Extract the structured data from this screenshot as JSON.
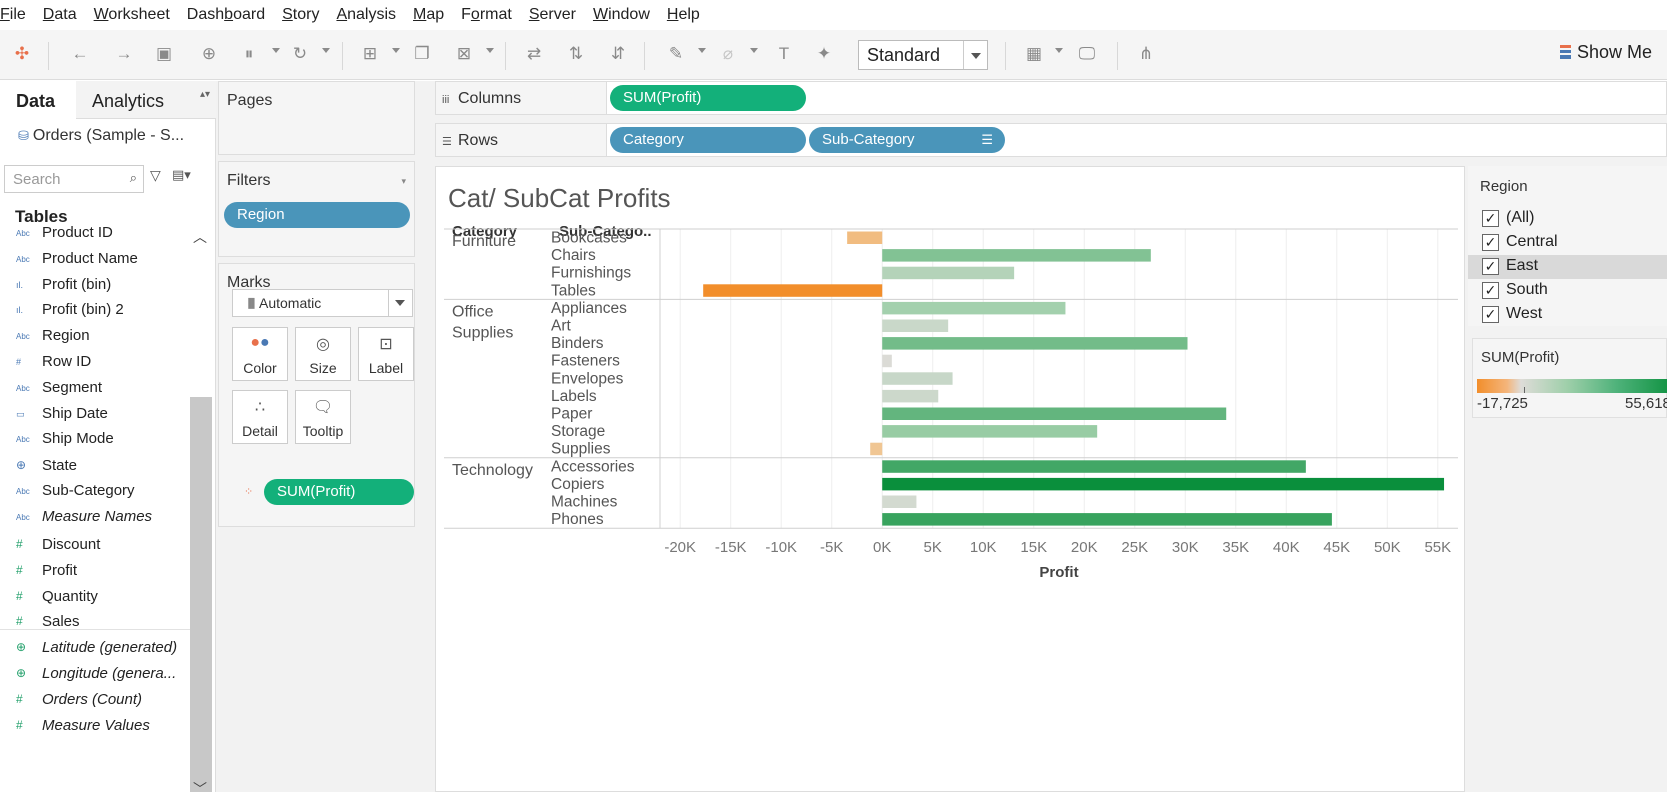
{
  "menu": [
    {
      "pre": "",
      "u": "F",
      "post": "ile"
    },
    {
      "pre": "",
      "u": "D",
      "post": "ata"
    },
    {
      "pre": "",
      "u": "W",
      "post": "orksheet"
    },
    {
      "pre": "Dash",
      "u": "b",
      "post": "oard"
    },
    {
      "pre": "",
      "u": "S",
      "post": "tory"
    },
    {
      "pre": "",
      "u": "A",
      "post": "nalysis"
    },
    {
      "pre": "",
      "u": "M",
      "post": "ap"
    },
    {
      "pre": "F",
      "u": "o",
      "post": "rmat"
    },
    {
      "pre": "",
      "u": "S",
      "post": "erver"
    },
    {
      "pre": "",
      "u": "W",
      "post": "indow"
    },
    {
      "pre": "",
      "u": "H",
      "post": "elp"
    }
  ],
  "toolbar": {
    "fit_select": "Standard",
    "show_me": "Show Me"
  },
  "datapane": {
    "tab_data": "Data",
    "tab_analytics": "Analytics",
    "datasource": "Orders (Sample - S...",
    "search_placeholder": "Search",
    "tables_heading": "Tables",
    "dimensions": [
      {
        "name": "Product ID",
        "type": "Abc"
      },
      {
        "name": "Product Name",
        "type": "Abc"
      },
      {
        "name": "Profit (bin)",
        "type": "bin"
      },
      {
        "name": "Profit (bin) 2",
        "type": "bin"
      },
      {
        "name": "Region",
        "type": "Abc"
      },
      {
        "name": "Row ID",
        "type": "#"
      },
      {
        "name": "Segment",
        "type": "Abc"
      },
      {
        "name": "Ship Date",
        "type": "date"
      },
      {
        "name": "Ship Mode",
        "type": "Abc"
      },
      {
        "name": "State",
        "type": "geo"
      },
      {
        "name": "Sub-Category",
        "type": "Abc"
      },
      {
        "name": "Measure Names",
        "type": "Abc",
        "italic": true
      }
    ],
    "measures": [
      {
        "name": "Discount",
        "type": "#"
      },
      {
        "name": "Profit",
        "type": "#"
      },
      {
        "name": "Quantity",
        "type": "#"
      },
      {
        "name": "Sales",
        "type": "#"
      },
      {
        "name": "Latitude (generated)",
        "type": "geo",
        "italic": true
      },
      {
        "name": "Longitude (genera...",
        "type": "geo",
        "italic": true
      },
      {
        "name": "Orders (Count)",
        "type": "#",
        "italic": true
      },
      {
        "name": "Measure Values",
        "type": "#",
        "italic": true
      }
    ]
  },
  "pages_title": "Pages",
  "filters": {
    "title": "Filters",
    "pill": "Region"
  },
  "marks": {
    "title": "Marks",
    "type": "Automatic",
    "buttons": [
      "Color",
      "Size",
      "Label",
      "Detail",
      "Tooltip"
    ],
    "pill": "SUM(Profit)"
  },
  "shelves": {
    "columns_label": "Columns",
    "rows_label": "Rows",
    "columns_pill": "SUM(Profit)",
    "rows_pills": [
      "Category",
      "Sub-Category"
    ]
  },
  "viz": {
    "title": "Cat/ SubCat Profits",
    "header_category": "Category",
    "header_subcategory": "Sub-Catego.."
  },
  "region_filter": {
    "title": "Region",
    "items": [
      {
        "label": "(All)",
        "checked": true
      },
      {
        "label": "Central",
        "checked": true
      },
      {
        "label": "East",
        "checked": true,
        "selected": true
      },
      {
        "label": "South",
        "checked": true
      },
      {
        "label": "West",
        "checked": true
      }
    ]
  },
  "color_legend": {
    "title": "SUM(Profit)",
    "min_label": "-17,725",
    "max_label": "55,618",
    "colors": {
      "negative": "#f28e2b",
      "neutral": "#dedcd8",
      "positive": "#0a8f3c"
    }
  },
  "chart_data": {
    "type": "bar",
    "orientation": "horizontal",
    "xlabel": "Profit",
    "xlim": [
      -22000,
      57000
    ],
    "xticks": [
      "-20K",
      "-15K",
      "-10K",
      "-5K",
      "0K",
      "5K",
      "10K",
      "15K",
      "20K",
      "25K",
      "30K",
      "35K",
      "40K",
      "45K",
      "50K",
      "55K"
    ],
    "xtick_values": [
      -20000,
      -15000,
      -10000,
      -5000,
      0,
      5000,
      10000,
      15000,
      20000,
      25000,
      30000,
      35000,
      40000,
      45000,
      50000,
      55000
    ],
    "groups": [
      {
        "category_line1": "Furniture",
        "category_line2": "",
        "rows": [
          {
            "sub": "Bookcases",
            "value": -3473
          },
          {
            "sub": "Chairs",
            "value": 26590
          },
          {
            "sub": "Furnishings",
            "value": 13059
          },
          {
            "sub": "Tables",
            "value": -17725
          }
        ]
      },
      {
        "category_line1": "Office",
        "category_line2": "Supplies",
        "rows": [
          {
            "sub": "Appliances",
            "value": 18138
          },
          {
            "sub": "Art",
            "value": 6528
          },
          {
            "sub": "Binders",
            "value": 30222
          },
          {
            "sub": "Fasteners",
            "value": 950
          },
          {
            "sub": "Envelopes",
            "value": 6964
          },
          {
            "sub": "Labels",
            "value": 5546
          },
          {
            "sub": "Paper",
            "value": 34054
          },
          {
            "sub": "Storage",
            "value": 21279
          },
          {
            "sub": "Supplies",
            "value": -1189
          }
        ]
      },
      {
        "category_line1": "Technology",
        "category_line2": "",
        "rows": [
          {
            "sub": "Accessories",
            "value": 41937
          },
          {
            "sub": "Copiers",
            "value": 55618
          },
          {
            "sub": "Machines",
            "value": 3385
          },
          {
            "sub": "Phones",
            "value": 44516
          }
        ]
      }
    ]
  }
}
